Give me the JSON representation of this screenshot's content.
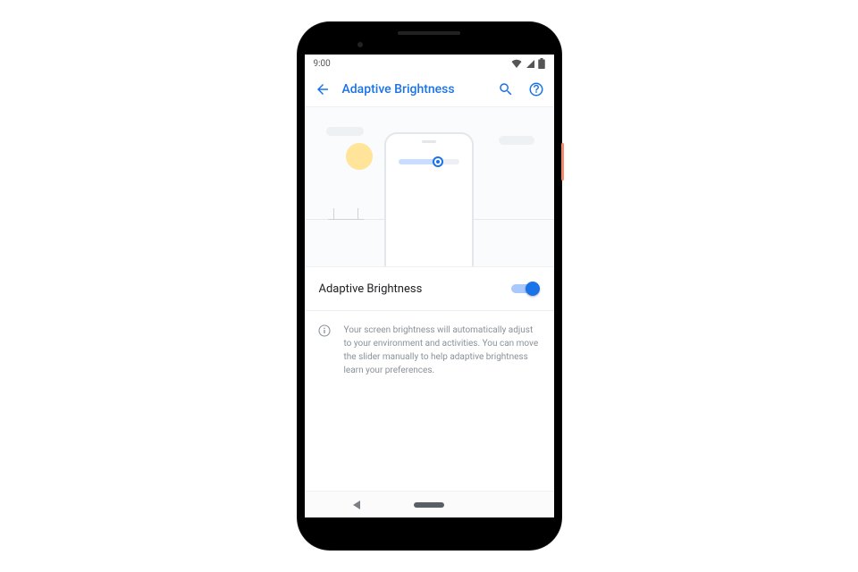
{
  "status_bar": {
    "time": "9:00"
  },
  "app_bar": {
    "title": "Adaptive Brightness"
  },
  "setting": {
    "label": "Adaptive Brightness",
    "enabled": true
  },
  "info": {
    "text": "Your screen brightness will automatically adjust to your environment and activities. You can move the slider manually to help adaptive brightness learn your preferences."
  },
  "colors": {
    "accent": "#1a73e8"
  }
}
